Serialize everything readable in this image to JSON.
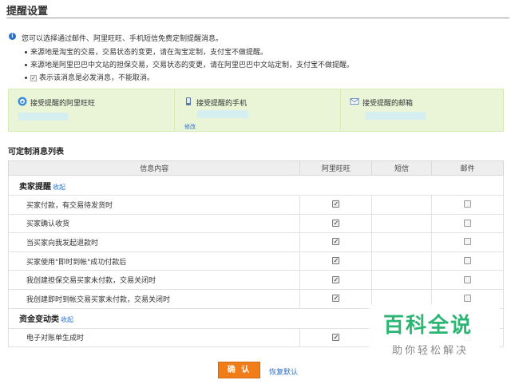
{
  "page": {
    "title": "提醒设置"
  },
  "intro": {
    "text": "您可以选择通过邮件、阿里旺旺、手机短信免费定制提醒消息。",
    "bullets": [
      "来源地是淘宝的交易，交易状态的变更，请在淘宝定制，支付宝不做提醒。",
      "来源地是阿里巴巴中文站的担保交易，交易状态的变更，请在阿里巴巴中文站定制，支付宝不做提醒。"
    ],
    "required_note": "表示该消息是必发消息，不能取消。"
  },
  "receivers": {
    "wangwang_label": "接受提醒的阿里旺旺",
    "phone_label": "接受提醒的手机",
    "phone_small": "修改",
    "email_label": "接受提醒的邮箱"
  },
  "list": {
    "title": "可定制消息列表",
    "headers": [
      "信息内容",
      "阿里旺旺",
      "短信",
      "邮件"
    ],
    "groups": [
      {
        "name": "卖家提醒",
        "collapse": "收起",
        "rows": [
          {
            "label": "买家付款，有交易待发货时",
            "wangwang": true,
            "email": false
          },
          {
            "label": "买家确认收货",
            "wangwang": true,
            "email": false
          },
          {
            "label": "当买家向我发起退款时",
            "wangwang": true,
            "email": false
          },
          {
            "label": "买家使用\"即时到帐\"成功付款后",
            "wangwang": true,
            "email": false
          },
          {
            "label": "我创建担保交易买家未付款，交易关闭时",
            "wangwang": true,
            "email": false
          },
          {
            "label": "我创建即时到帐交易买家未付款，交易关闭时",
            "wangwang": true,
            "email": false
          }
        ]
      },
      {
        "name": "资金变动类",
        "collapse": "收起",
        "rows": [
          {
            "label": "电子对账单生成时",
            "wangwang": true,
            "email": false
          }
        ]
      }
    ]
  },
  "actions": {
    "confirm": "确 认",
    "restore": "恢复默认"
  },
  "watermark": {
    "line1": "百科全说",
    "line2": "助你轻松解决"
  },
  "colors": {
    "accent": "#f07d18",
    "link": "#2e6fc4",
    "panel": "#eaf5d8",
    "watermark": "#2bb673"
  }
}
